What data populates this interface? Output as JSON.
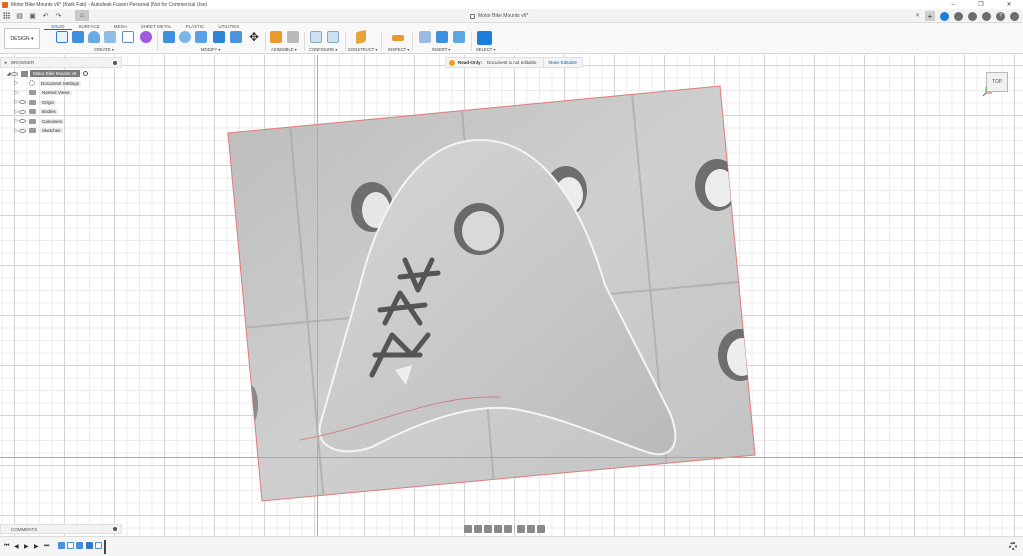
{
  "window": {
    "title": "Motor Bike Mounts v6* (Kwik Fab) - Autodesk Fusion Personal (Not for Commercial Use)",
    "controls": [
      "–",
      "❐",
      "✕"
    ]
  },
  "document_tab": {
    "label": "Motor Bike Mounts v6*",
    "close": "✕"
  },
  "toolbar": {
    "workspace": "DESIGN ▾",
    "tabs": [
      {
        "label": "SOLID",
        "active": true
      },
      {
        "label": "SURFACE",
        "active": false
      },
      {
        "label": "MESH",
        "active": false
      },
      {
        "label": "SHEET METAL",
        "active": false
      },
      {
        "label": "PLASTIC",
        "active": false
      },
      {
        "label": "UTILITIES",
        "active": false
      }
    ],
    "groups": {
      "create": "CREATE ▾",
      "modify": "MODIFY ▾",
      "assemble": "ASSEMBLE ▾",
      "configure": "CONFIGURE ▾",
      "construct": "CONSTRUCT ▾",
      "inspect": "INSPECT ▾",
      "insert": "INSERT ▾",
      "select": "SELECT ▾"
    }
  },
  "browser": {
    "title": "BROWSER",
    "root": "Motor Bike Mounts v6",
    "items": [
      {
        "label": "Document Settings",
        "icon": "gear-icon"
      },
      {
        "label": "Named Views",
        "icon": "folder-icon"
      },
      {
        "label": "Origin",
        "icon": "folder-icon"
      },
      {
        "label": "Bodies",
        "icon": "folder-icon"
      },
      {
        "label": "Canvases",
        "icon": "folder-icon"
      },
      {
        "label": "Sketches",
        "icon": "folder-icon"
      }
    ]
  },
  "readonly_banner": {
    "label": "Read-Only:",
    "message": "Document is not editable",
    "action": "Make Editable"
  },
  "viewcube": {
    "face": "TOP"
  },
  "comments": {
    "title": "COMMENTS"
  },
  "colors": {
    "accent": "#0b6bc4",
    "grid": "#d4d4d4",
    "x_axis": "#e88a8a",
    "y_axis": "#7bd17b"
  }
}
